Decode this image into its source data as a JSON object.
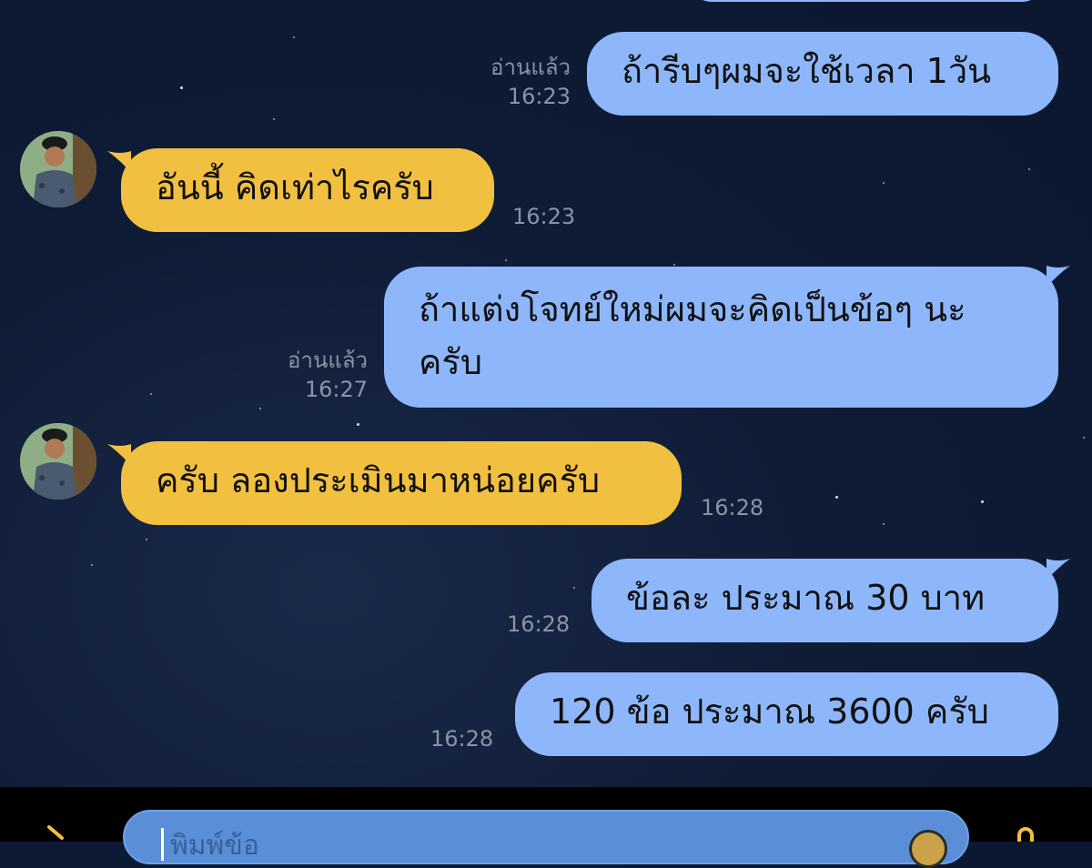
{
  "messages": [
    {
      "side": "me",
      "text": "",
      "read": "",
      "time": ""
    },
    {
      "side": "me",
      "text": "ถ้ารีบๆผมจะใช้เวลา 1วัน",
      "read": "อ่านแล้ว",
      "time": "16:23"
    },
    {
      "side": "them",
      "text": "อันนี้ คิดเท่าไรครับ",
      "time": "16:23"
    },
    {
      "side": "me",
      "text": "ถ้าแต่งโจทย์ใหม่ผมจะคิดเป็นข้อๆ นะครับ",
      "line1": "ถ้าแต่งโจทย์ใหม่ผมจะคิดเป็นข้อๆ นะ",
      "line2": "ครับ",
      "read": "อ่านแล้ว",
      "time": "16:27"
    },
    {
      "side": "them",
      "text": "ครับ ลองประเมินมาหน่อยครับ",
      "time": "16:28"
    },
    {
      "side": "me",
      "text": "ข้อละ ประมาณ 30 บาท",
      "time": "16:28"
    },
    {
      "side": "me",
      "text": "120 ข้อ ประมาณ 3600 ครับ",
      "time": "16:28"
    }
  ],
  "input": {
    "placeholder": "พิมพ์ข้อ"
  },
  "icons": {
    "left": "chevron-right-icon",
    "right": "microphone-icon",
    "emoji": "sticker-icon"
  },
  "colors": {
    "my_bubble": "#8db7fa",
    "their_bubble": "#f2c040",
    "background": "#0f1c36",
    "meta": "#8a93a6"
  }
}
